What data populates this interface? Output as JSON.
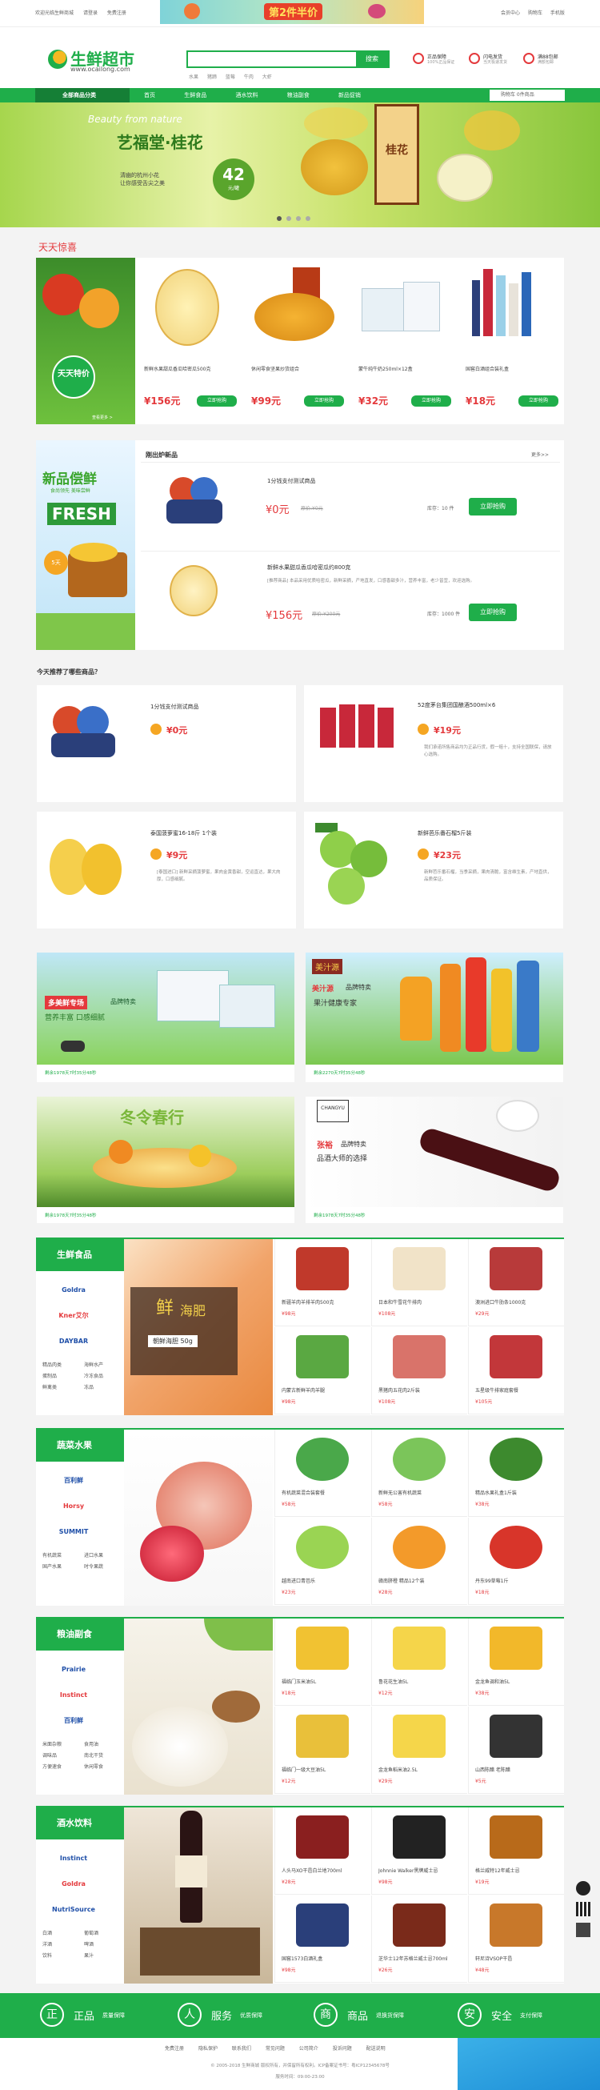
{
  "topbar": {
    "left": [
      "欢迎光临生鲜商城",
      "请登录",
      "免费注册"
    ],
    "promo": "第2件半价",
    "right": [
      "会员中心",
      "购物车",
      "手机版"
    ]
  },
  "logo": {
    "name": "生鲜超市",
    "url": "www.ocailong.com"
  },
  "search": {
    "placeholder": "",
    "button": "搜索",
    "hot": [
      "水果",
      "猪蹄",
      "蓝莓",
      "牛肉",
      "大虾"
    ]
  },
  "badges": [
    {
      "t": "正品保障",
      "s": "100%正品保证"
    },
    {
      "t": "闪电发货",
      "s": "当天极速发货"
    },
    {
      "t": "满88包邮",
      "s": "满额包邮"
    }
  ],
  "nav": {
    "category": "全部商品分类",
    "items": [
      "首页",
      "生鲜食品",
      "酒水饮料",
      "粮油副食",
      "新品促销"
    ],
    "cart": "购物车 0件商品"
  },
  "banner": {
    "script": "Beauty from nature",
    "title": "艺福堂·桂花",
    "sub1": "清幽的杭州小花",
    "sub2": "让你感受舌尖之美",
    "price": "42",
    "unit": "元/罐",
    "jar": "桂花"
  },
  "daily": {
    "title": "天天惊喜",
    "tag": "天天特价",
    "more": "查看更多 >",
    "items": [
      {
        "name": "新鲜水果甜瓜香瓜哈密瓜500克",
        "price": "¥156元",
        "btn": "立即抢购"
      },
      {
        "name": "休闲零食坚果炒货组合",
        "price": "¥99元",
        "btn": "立即抢购"
      },
      {
        "name": "蒙牛纯牛奶250ml×12盒",
        "price": "¥32元",
        "btn": "立即抢购"
      },
      {
        "name": "国窖白酒组合装礼盒",
        "price": "¥18元",
        "btn": "立即抢购"
      }
    ]
  },
  "fresh": {
    "title": "刚出炉新品",
    "more": "更多>>",
    "banner_cn": "新品偿鲜",
    "banner_sub": "食尚领先  美味尝鲜",
    "banner_en": "FRESH",
    "days": "5天",
    "items": [
      {
        "name": "1分钱支付测试商品",
        "price": "¥0元",
        "old": "原价:¥0元",
        "stock": "库存：10 件",
        "btn": "立即抢购"
      },
      {
        "name": "新鲜水果甜瓜香瓜哈密瓜约800克",
        "desc": "[推荐商品] 本品采用优质哈密瓜，新鲜采摘，产地直发，口感香甜多汁，营养丰富，老少皆宜，欢迎选购。",
        "price": "¥156元",
        "old": "原价:¥200元",
        "stock": "库存：1000 件",
        "btn": "立即抢购"
      }
    ]
  },
  "recommend": {
    "title": "今天推荐了哪些商品？",
    "items": [
      {
        "name": "1分钱支付测试商品",
        "price": "¥0元",
        "desc": ""
      },
      {
        "name": "52度茅台集团国酿酒500ml×6",
        "price": "¥19元",
        "desc": "我们承诺所售商品均为正品行货，假一赔十，支持全国联保，请放心选购。"
      },
      {
        "name": "泰国菠萝蜜16-18斤 1个装",
        "price": "¥9元",
        "desc": "[泰国进口] 新鲜采摘菠萝蜜，果肉金黄香甜，空运直达，果大肉厚，口感细腻。"
      },
      {
        "name": "新鲜芭乐番石榴5斤装",
        "price": "¥23元",
        "desc": "新鲜芭乐番石榴，当季采摘，果肉清脆，富含维生素，产地直供，品质保证。"
      }
    ]
  },
  "promos": [
    {
      "brand": "多美鲜专场",
      "brand2": "品牌特卖",
      "slogan": "营养丰富 口感细腻",
      "time": "剩余1978天7时35分48秒"
    },
    {
      "brand": "美汁源",
      "brand2": "品牌特卖",
      "slogan": "果汁健康专家",
      "time": "剩余2270天7时35分48秒"
    },
    {
      "brand": "冬令春行",
      "brand2": "",
      "slogan": "",
      "time": "剩余1978天7时35分48秒"
    },
    {
      "brand": "张裕",
      "brand2": "品牌特卖",
      "slogan": "品酒大师的选择",
      "time": "剩余1978天7时35分48秒"
    }
  ],
  "floors": [
    {
      "title": "生鲜食品",
      "brands": [
        "Goldra",
        "Kner艾尔",
        "DAYBAR"
      ],
      "links": [
        "精品肉类",
        "海鲜水产",
        "蛋制品",
        "冷冻食品",
        "鲜禽类",
        "冻品"
      ],
      "feature": {
        "t": "鲜",
        "t2": "海肥",
        "sub": "朝鲜海胆 50g"
      },
      "cells": [
        {
          "n": "新疆羊肉羊排羊肉500克",
          "p": "¥98元"
        },
        {
          "n": "日本和牛雪花牛排肉",
          "p": "¥108元"
        },
        {
          "n": "澳洲进口牛肋条1000克",
          "p": "¥29元"
        },
        {
          "n": "内蒙古新鲜羊肉羊腿",
          "p": "¥98元"
        },
        {
          "n": "黑猪肉五花肉2斤装",
          "p": "¥108元"
        },
        {
          "n": "五星级牛排家庭套餐",
          "p": "¥105元"
        }
      ]
    },
    {
      "title": "蔬菜水果",
      "brands": [
        "百利鲜",
        "Horsy",
        "SUMMIT"
      ],
      "links": [
        "有机蔬菜",
        "进口水果",
        "国产水果",
        "时令果蔬"
      ],
      "feature": {
        "t": "",
        "t2": "",
        "sub": ""
      },
      "cells": [
        {
          "n": "有机蔬菜混合装套餐",
          "p": "¥58元"
        },
        {
          "n": "新鲜无公害有机蔬菜",
          "p": "¥58元"
        },
        {
          "n": "精品水果礼盒1斤装",
          "p": "¥38元"
        },
        {
          "n": "越南进口青芭乐",
          "p": "¥23元"
        },
        {
          "n": "赣南脐橙 精品12个装",
          "p": "¥28元"
        },
        {
          "n": "丹东99草莓1斤",
          "p": "¥18元"
        }
      ]
    },
    {
      "title": "粮油副食",
      "brands": [
        "Prairie",
        "Instinct",
        "百利鲜"
      ],
      "links": [
        "米面杂粮",
        "食用油",
        "调味品",
        "南北干货",
        "方便速食",
        "休闲零食"
      ],
      "feature": {
        "t": "",
        "t2": "",
        "sub": ""
      },
      "cells": [
        {
          "n": "福临门玉米油5L",
          "p": "¥18元"
        },
        {
          "n": "鲁花花生油5L",
          "p": "¥12元"
        },
        {
          "n": "金龙鱼调和油5L",
          "p": "¥38元"
        },
        {
          "n": "福临门一级大豆油5L",
          "p": "¥12元"
        },
        {
          "n": "金龙鱼稻米油2.5L",
          "p": "¥29元"
        },
        {
          "n": "山西陈醋 老陈醋",
          "p": "¥5元"
        }
      ]
    },
    {
      "title": "酒水饮料",
      "brands": [
        "Instinct",
        "Goldra",
        "NutriSource"
      ],
      "links": [
        "白酒",
        "葡萄酒",
        "洋酒",
        "啤酒",
        "饮料",
        "果汁"
      ],
      "feature": {
        "t": "",
        "t2": "",
        "sub": ""
      },
      "cells": [
        {
          "n": "人头马XO干邑白兰地700ml",
          "p": "¥28元"
        },
        {
          "n": "Johnnie Walker黑牌威士忌",
          "p": "¥98元"
        },
        {
          "n": "格兰威特12年威士忌",
          "p": "¥19元"
        },
        {
          "n": "国窖1573白酒礼盒",
          "p": "¥98元"
        },
        {
          "n": "芝华士12年苏格兰威士忌700ml",
          "p": "¥26元"
        },
        {
          "n": "轩尼诗VSOP干邑",
          "p": "¥48元"
        }
      ]
    }
  ],
  "services": [
    {
      "icon": "正",
      "t": "正品",
      "s": "质量保障"
    },
    {
      "icon": "人",
      "t": "服务",
      "s": "优质保障"
    },
    {
      "icon": "商",
      "t": "商品",
      "s": "退换货保障"
    },
    {
      "icon": "安",
      "t": "安全",
      "s": "支付保障"
    }
  ],
  "footer": {
    "links": [
      "免费注册",
      "隐私保护",
      "联系我们",
      "常见问题",
      "公司简介",
      "投诉问题",
      "配送说明"
    ],
    "copy": "© 2005-2018 生鲜商城 版权所有，并保留所有权利。ICP备案证书号：粤ICP12345678号",
    "hours": "服务时间：09:00-23:00"
  }
}
